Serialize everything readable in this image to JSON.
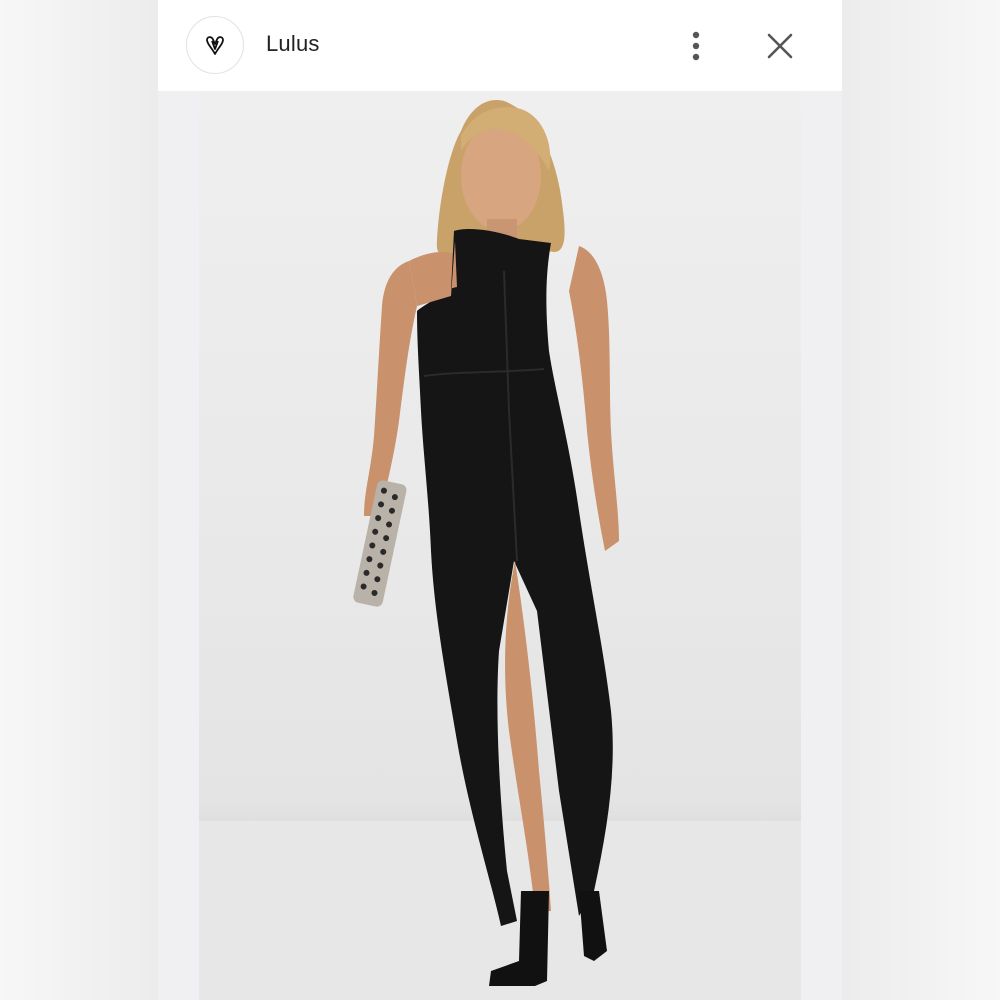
{
  "header": {
    "brand_name": "Lulus",
    "avatar_icon": "heart-v-logo",
    "more_icon": "vertical-ellipsis-icon",
    "close_icon": "close-icon"
  },
  "image": {
    "subject": "product-photo",
    "colors": {
      "dress": "#151515",
      "background": "#ececec",
      "skin": "#c9916c",
      "hair": "#c9a26a"
    }
  }
}
